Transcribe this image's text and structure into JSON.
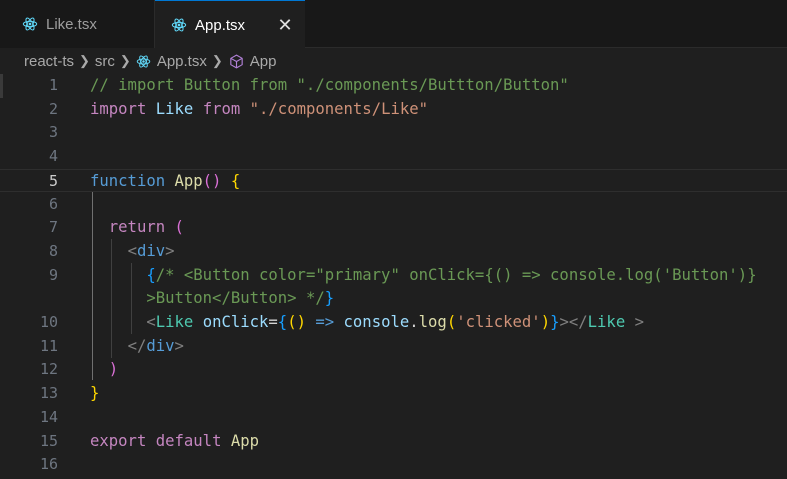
{
  "tabs": [
    {
      "label": "Like.tsx",
      "active": false
    },
    {
      "label": "App.tsx",
      "active": true
    }
  ],
  "tab_close_icon": "close-icon",
  "breadcrumb": {
    "folder1": "react-ts",
    "folder2": "src",
    "file": "App.tsx",
    "symbol": "App"
  },
  "editor": {
    "current_line": 5,
    "line_numbers": [
      "1",
      "2",
      "3",
      "4",
      "5",
      "6",
      "7",
      "8",
      "9",
      "",
      "10",
      "11",
      "12",
      "13",
      "14",
      "15",
      "16"
    ],
    "line1": {
      "comment": "// import Button from \"./components/Buttton/Button\""
    },
    "line2": {
      "kw": "import",
      "ident": "Like",
      "kw2": "from",
      "str": "\"./components/Like\""
    },
    "line5": {
      "kw": "function",
      "fn": "App",
      "paren": "()",
      "brace": "{"
    },
    "line7": {
      "kw": "return",
      "paren": "("
    },
    "line8": {
      "open": "<",
      "tag": "div",
      "close": ">"
    },
    "line9a": {
      "brace": "{",
      "comment": "/* <Button color=\"primary\" onClick={() => console.log('Button')}"
    },
    "line9b": {
      "comment": ">Button</Button> */",
      "brace": "}"
    },
    "line10": {
      "open": "<",
      "tag": "Like",
      "attr": "onClick",
      "eq": "=",
      "b1": "{",
      "p1": "(",
      "p2": ")",
      "arrow": "=>",
      "obj": "console",
      "dot": ".",
      "fn": "log",
      "p3": "(",
      "str": "'clicked'",
      "p4": ")",
      "b2": "}",
      "gt": ">",
      "closeopen": "</",
      "tag2": "Like",
      "closegt": " >"
    },
    "line11": {
      "open": "</",
      "tag": "div",
      "close": ">"
    },
    "line12": {
      "paren": ")"
    },
    "line13": {
      "brace": "}"
    },
    "line15": {
      "kw": "export",
      "kw2": "default",
      "ident": "App"
    }
  }
}
